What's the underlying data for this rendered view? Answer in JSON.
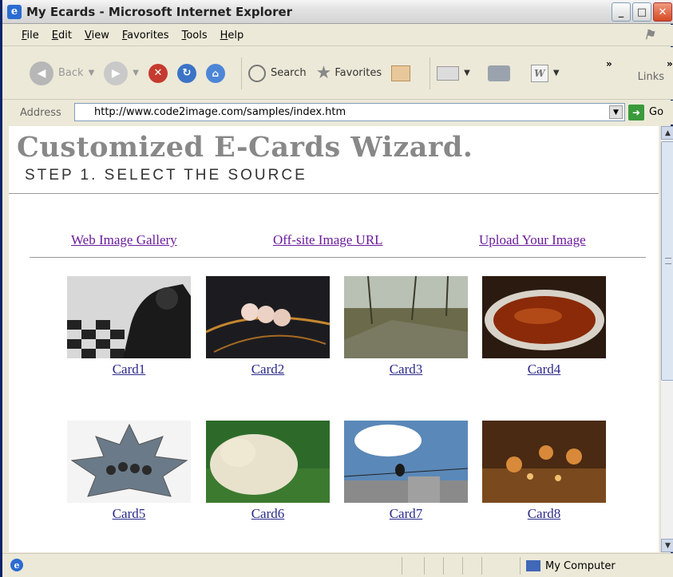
{
  "window": {
    "title": "My Ecards - Microsoft Internet Explorer"
  },
  "menu": [
    "File",
    "Edit",
    "View",
    "Favorites",
    "Tools",
    "Help"
  ],
  "toolbar": {
    "back_label": "Back",
    "search_label": "Search",
    "favorites_label": "Favorites",
    "more_label": "»",
    "links_label": "Links",
    "links_more": "»"
  },
  "address": {
    "label": "Address",
    "url": "http://www.code2image.com/samples/index.htm",
    "go_label": "Go"
  },
  "page": {
    "title": "Customized E-Cards Wizard.",
    "step": "STEP 1. SELECT THE SOURCE",
    "source_links": [
      "Web Image Gallery",
      "Off-site Image URL",
      "Upload Your Image"
    ],
    "cards": [
      {
        "label": "Card1"
      },
      {
        "label": "Card2"
      },
      {
        "label": "Card3"
      },
      {
        "label": "Card4"
      },
      {
        "label": "Card5"
      },
      {
        "label": "Card6"
      },
      {
        "label": "Card7"
      },
      {
        "label": "Card8"
      }
    ]
  },
  "status": {
    "zone": "My Computer"
  },
  "colors": {
    "titlebar": "#e2e2e2",
    "chrome": "#ece9d8",
    "visited_link": "#6a1a9a",
    "link": "#2a2a8a",
    "title_gray": "#888888"
  }
}
